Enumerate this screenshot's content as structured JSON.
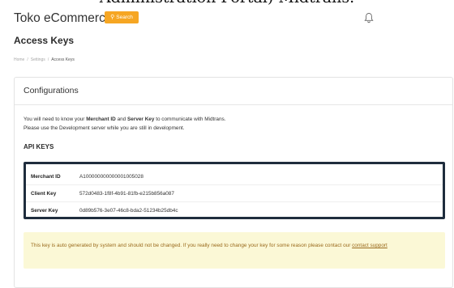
{
  "top_clip": "Administration Portal) Midtrans.",
  "header": {
    "app_title": "Toko eCommerce",
    "search_label": "Search"
  },
  "page": {
    "title": "Access Keys",
    "breadcrumb": [
      "Home",
      "Settings",
      "Access Keys"
    ]
  },
  "card": {
    "title": "Configurations",
    "desc": {
      "l1_a": "You will need to know your ",
      "l1_b": "Merchant ID",
      "l1_c": " and ",
      "l1_d": "Server Key",
      "l1_e": " to communicate with Midtrans.",
      "l2": "Please use the Development server while you are still in development."
    },
    "api_keys_heading": "API KEYS",
    "keys": [
      {
        "label": "Merchant ID",
        "value": "A100000000000001005028"
      },
      {
        "label": "Client Key",
        "value": "572d0483-1f8f-4b91-81fb-e215b856a087"
      },
      {
        "label": "Server Key",
        "value": "0d89b576-3e07-46c8-bda2-51234b25db4c"
      }
    ],
    "notice": {
      "text": "This key is auto generated by system and should not be changed. If you really need to change your key for some reason please contact our ",
      "link": "contact support"
    }
  },
  "colors": {
    "accent": "#f6a623",
    "keys_border": "#1f2d3d",
    "notice_bg": "#fbf8d6"
  }
}
